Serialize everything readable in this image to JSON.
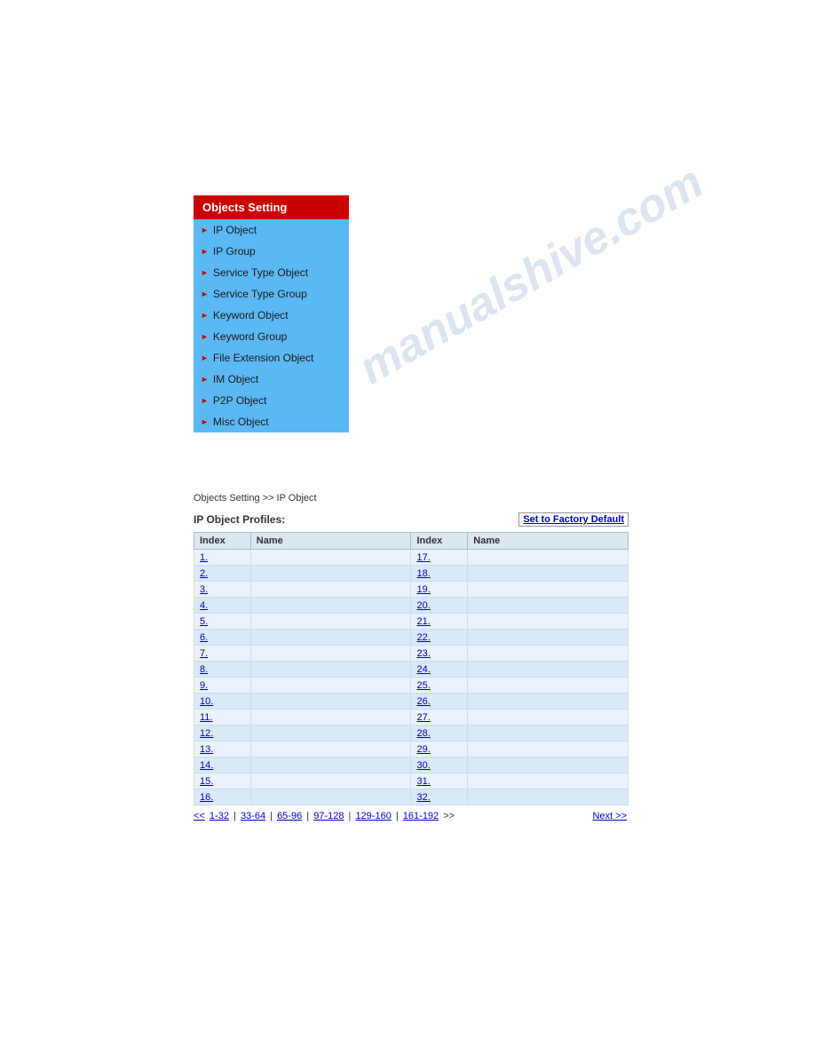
{
  "sidebar": {
    "header": "Objects Setting",
    "items": [
      {
        "label": "IP Object",
        "id": "ip-object"
      },
      {
        "label": "IP Group",
        "id": "ip-group"
      },
      {
        "label": "Service Type Object",
        "id": "service-type-object"
      },
      {
        "label": "Service Type Group",
        "id": "service-type-group"
      },
      {
        "label": "Keyword Object",
        "id": "keyword-object"
      },
      {
        "label": "Keyword Group",
        "id": "keyword-group"
      },
      {
        "label": "File Extension Object",
        "id": "file-extension-object"
      },
      {
        "label": "IM Object",
        "id": "im-object"
      },
      {
        "label": "P2P Object",
        "id": "p2p-object"
      },
      {
        "label": "Misc Object",
        "id": "misc-object"
      }
    ]
  },
  "watermark": "manualshive.com",
  "breadcrumb": "Objects Setting >> IP Object",
  "profiles_label": "IP Object Profiles:",
  "factory_default": "Set to Factory Default",
  "table": {
    "headers": [
      "Index",
      "Name",
      "Index",
      "Name"
    ],
    "left_rows": [
      "1.",
      "2.",
      "3.",
      "4.",
      "5.",
      "6.",
      "7.",
      "8.",
      "9.",
      "10.",
      "11.",
      "12.",
      "13.",
      "14.",
      "15.",
      "16."
    ],
    "right_rows": [
      "17.",
      "18.",
      "19.",
      "20.",
      "21.",
      "22.",
      "23.",
      "24.",
      "25.",
      "26.",
      "27.",
      "28.",
      "29.",
      "30.",
      "31.",
      "32."
    ]
  },
  "pagination": {
    "prev": "<<",
    "pages": [
      "1-32",
      "33-64",
      "65-96",
      "97-128",
      "129-160",
      "161-192"
    ],
    "separator": "|",
    "next_label": ">>",
    "next_text": "Next >>"
  }
}
